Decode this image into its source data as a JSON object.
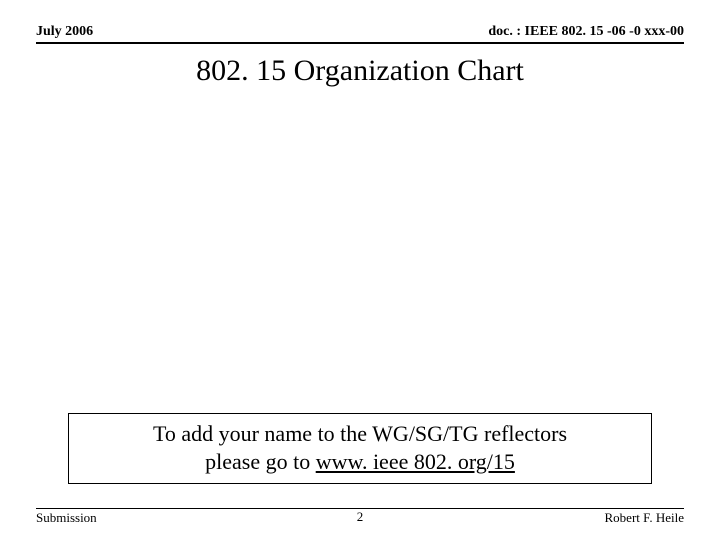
{
  "header": {
    "date": "July 2006",
    "docref": "doc. : IEEE 802. 15 -06 -0 xxx-00"
  },
  "title": "802. 15 Organization Chart",
  "note": {
    "line1": "To add your name to the WG/SG/TG reflectors",
    "line2_prefix": "please go to ",
    "link_text": "www. ieee 802. org/15"
  },
  "footer": {
    "left": "Submission",
    "center": "2",
    "right": "Robert F. Heile"
  }
}
